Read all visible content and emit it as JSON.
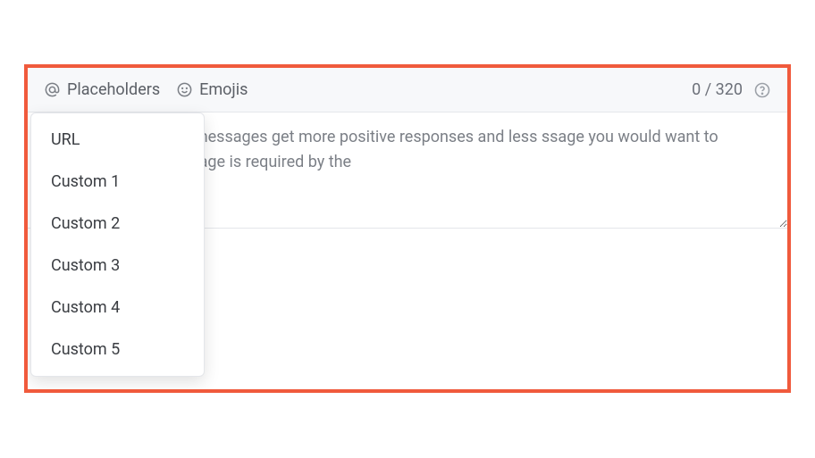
{
  "toolbar": {
    "placeholders_label": "Placeholders",
    "emojis_label": "Emojis",
    "char_counter": "0 / 320"
  },
  "textarea": {
    "placeholder": "here. Friendly, chatty messages get more positive responses and less ssage you would want to receive! Opt out language is required by the",
    "value": ""
  },
  "dropdown": {
    "items": [
      {
        "label": "URL"
      },
      {
        "label": "Custom 1"
      },
      {
        "label": "Custom 2"
      },
      {
        "label": "Custom 3"
      },
      {
        "label": "Custom 4"
      },
      {
        "label": "Custom 5"
      }
    ]
  }
}
